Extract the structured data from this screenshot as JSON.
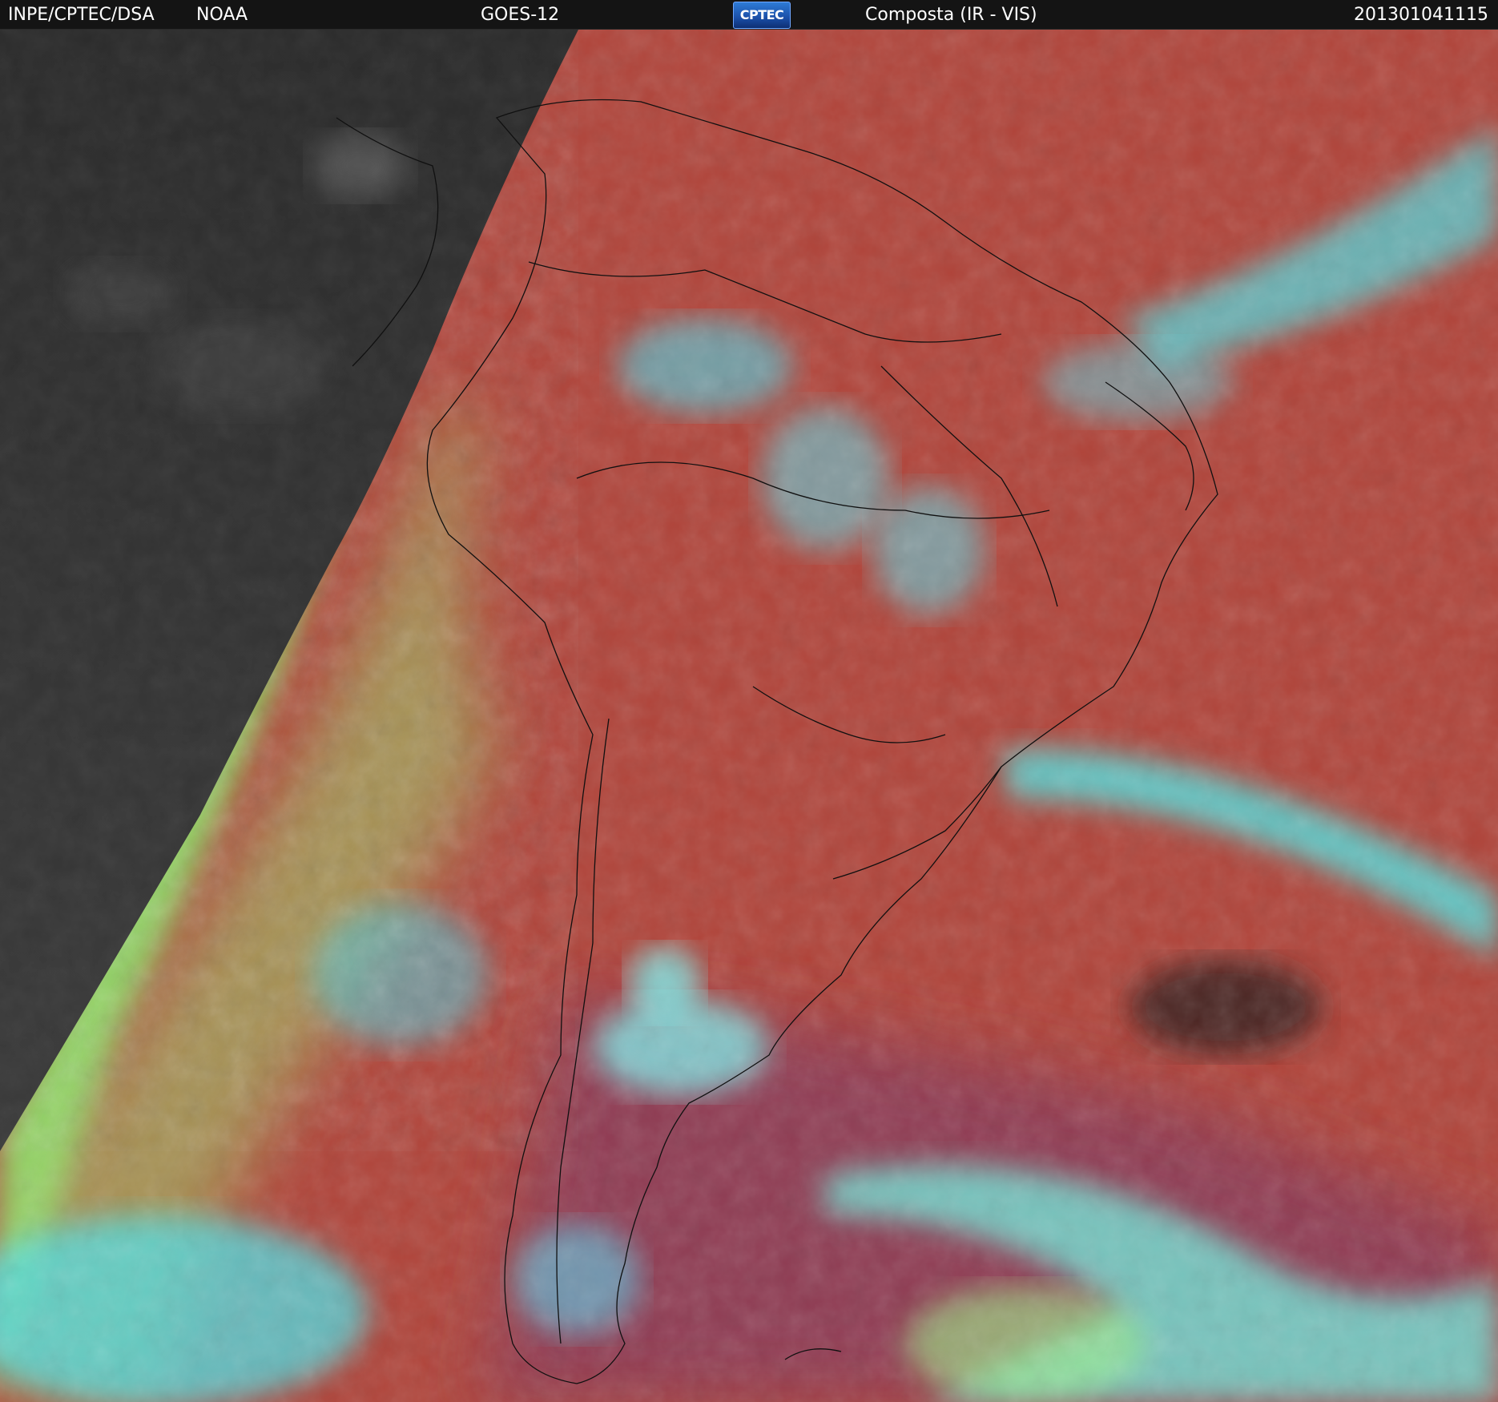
{
  "header": {
    "source": "INPE/CPTEC/DSA",
    "agency": "NOAA",
    "satellite": "GOES-12",
    "logo_text": "CPTEC",
    "product": "Composta (IR - VIS)",
    "timestamp": "201301041115"
  },
  "colors": {
    "header_bg": "#141414",
    "night_side": "#2f2f2f",
    "land_ir": "#b0443a",
    "cloud_cyan": "#4fe0e6",
    "cloud_green": "#8fe36a",
    "ocean_south": "#8a3a58"
  }
}
